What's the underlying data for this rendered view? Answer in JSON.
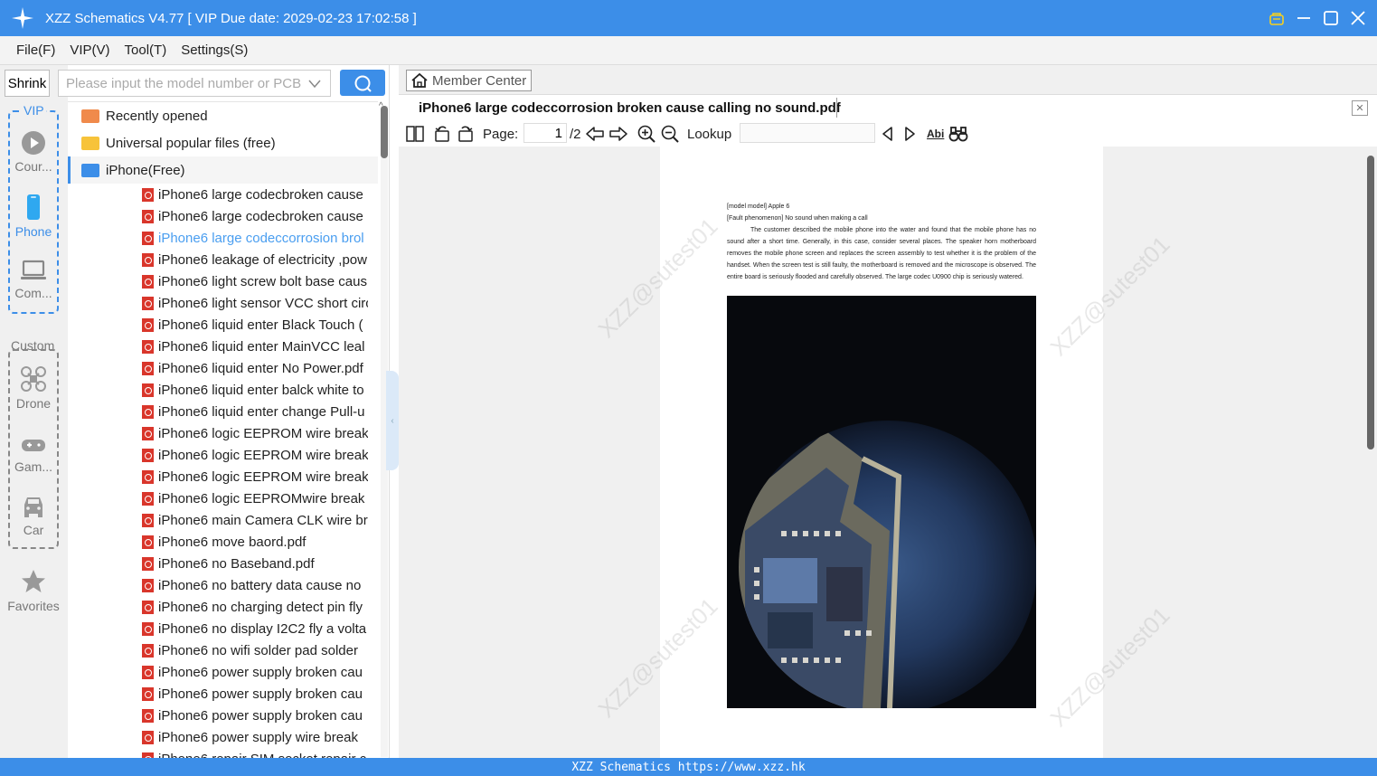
{
  "window": {
    "title": "XZZ Schematics V4.77 [ VIP Due date: 2029-02-23 17:02:58 ]"
  },
  "menu": [
    "File(F)",
    "VIP(V)",
    "Tool(T)",
    "Settings(S)"
  ],
  "left": {
    "shrink": "Shrink",
    "vip_label": "VIP",
    "custom_label": "Custom",
    "vip_items": [
      "Cour...",
      "Phone",
      "Com..."
    ],
    "custom_items": [
      "Drone",
      "Gam...",
      "Car"
    ],
    "favorites": "Favorites"
  },
  "search": {
    "placeholder": "Please input the model number or PCB"
  },
  "tree": {
    "folders": [
      "Recently opened",
      "Universal popular files (free)",
      "iPhone(Free)"
    ],
    "files": [
      "iPhone6 large codecbroken cause",
      "iPhone6 large codecbroken cause",
      "iPhone6 large codeccorrosion brol",
      "iPhone6 leakage of electricity ,pow",
      "iPhone6 light screw bolt base caus",
      "iPhone6 light sensor VCC short circ",
      "iPhone6 liquid enter Black Touch (",
      "iPhone6 liquid enter MainVCC leal",
      "iPhone6 liquid enter No Power.pdf",
      "iPhone6 liquid enter balck white to",
      "iPhone6 liquid enter change Pull-u",
      "iPhone6 logic EEPROM wire break",
      "iPhone6 logic EEPROM wire break",
      "iPhone6 logic EEPROM wire break",
      "iPhone6 logic EEPROMwire break",
      "iPhone6 main Camera CLK wire bre",
      "iPhone6 move baord.pdf",
      "iPhone6 no Baseband.pdf",
      "iPhone6 no battery data cause no",
      "iPhone6 no charging detect pin fly",
      "iPhone6 no display I2C2 fly a volta",
      "iPhone6 no wifi solder pad solder",
      "iPhone6 power supply broken cau",
      "iPhone6 power supply broken cau",
      "iPhone6 power supply broken cau",
      "iPhone6 power supply wire break",
      "iPhone6 repair SIM socket repair c"
    ],
    "selected_index": 2
  },
  "viewer": {
    "member_center": "Member Center",
    "doc_title": "iPhone6 large codeccorrosion broken cause calling no sound.pdf",
    "page_label": "Page:",
    "page_current": "1",
    "page_total": "/2",
    "lookup_label": "Lookup",
    "abi": "Abi",
    "page_lines": [
      "[model model] Apple 6",
      "[Fault phenomenon] No sound when making a call",
      "The customer described the mobile phone into the water and found that the mobile phone has no sound after a short time. Generally, in this case, consider several places. The speaker horn motherboard removes the mobile phone screen and replaces the screen assembly to test whether it is the problem of the handset. When the screen test is still faulty, the motherboard is removed and the microscope is observed. The entire board is seriously flooded and carefully observed. The large codec U0900 chip is seriously watered."
    ],
    "watermark": "XZZ@sutest01"
  },
  "status": "XZZ Schematics https://www.xzz.hk"
}
